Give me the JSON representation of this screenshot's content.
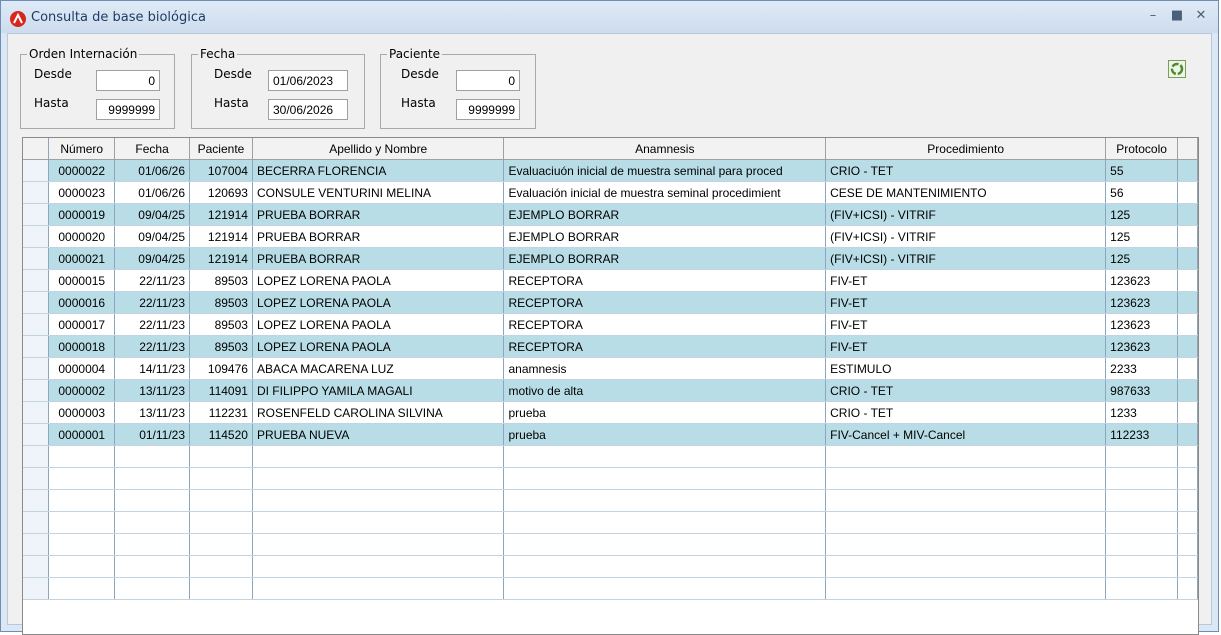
{
  "window": {
    "title": "Consulta de base biológica"
  },
  "filters": {
    "orden": {
      "legend": "Orden Internación",
      "desde_label": "Desde",
      "desde": "0",
      "hasta_label": "Hasta",
      "hasta": "9999999"
    },
    "fecha": {
      "legend": "Fecha",
      "desde_label": "Desde",
      "desde": "01/06/2023",
      "hasta_label": "Hasta",
      "hasta": "30/06/2026"
    },
    "paciente": {
      "legend": "Paciente",
      "desde_label": "Desde",
      "desde": "0",
      "hasta_label": "Hasta",
      "hasta": "9999999"
    }
  },
  "table": {
    "columns": [
      "Número",
      "Fecha",
      "Paciente",
      "Apellido y Nombre",
      "Anamnesis",
      "Procedimiento",
      "Protocolo"
    ],
    "rows": [
      [
        "0000022",
        "01/06/26",
        "107004",
        " BECERRA FLORENCIA",
        "Evaluaciuón inicial de muestra seminal para proced",
        "CRIO - TET",
        "55"
      ],
      [
        "0000023",
        "01/06/26",
        "120693",
        " CONSULE VENTURINI MELINA",
        "Evaluación inicial de muestra seminal procedimient",
        "CESE DE MANTENIMIENTO",
        "56"
      ],
      [
        "0000019",
        "09/04/25",
        "121914",
        "PRUEBA BORRAR",
        "EJEMPLO BORRAR",
        "(FIV+ICSI) - VITRIF",
        "125"
      ],
      [
        "0000020",
        "09/04/25",
        "121914",
        "PRUEBA BORRAR",
        "EJEMPLO BORRAR",
        "(FIV+ICSI) - VITRIF",
        "125"
      ],
      [
        "0000021",
        "09/04/25",
        "121914",
        "PRUEBA BORRAR",
        "EJEMPLO BORRAR",
        "(FIV+ICSI) - VITRIF",
        "125"
      ],
      [
        "0000015",
        "22/11/23",
        "89503",
        "LOPEZ LORENA PAOLA",
        "RECEPTORA",
        "FIV-ET",
        "123623"
      ],
      [
        "0000016",
        "22/11/23",
        "89503",
        "LOPEZ LORENA PAOLA",
        "RECEPTORA",
        "FIV-ET",
        "123623"
      ],
      [
        "0000017",
        "22/11/23",
        "89503",
        "LOPEZ LORENA PAOLA",
        "RECEPTORA",
        "FIV-ET",
        "123623"
      ],
      [
        "0000018",
        "22/11/23",
        "89503",
        "LOPEZ LORENA PAOLA",
        "RECEPTORA",
        "FIV-ET",
        "123623"
      ],
      [
        "0000004",
        "14/11/23",
        "109476",
        "ABACA MACARENA LUZ",
        "anamnesis",
        "ESTIMULO",
        "2233"
      ],
      [
        "0000002",
        "13/11/23",
        "114091",
        "DI FILIPPO YAMILA MAGALI",
        "motivo de alta",
        "CRIO - TET",
        "987633"
      ],
      [
        "0000003",
        "13/11/23",
        "112231",
        "ROSENFELD CAROLINA SILVINA",
        "prueba",
        "CRIO - TET",
        "1233"
      ],
      [
        "0000001",
        "01/11/23",
        "114520",
        "PRUEBA NUEVA",
        "prueba",
        "FIV-Cancel + MIV-Cancel",
        "112233"
      ]
    ],
    "highlighted_rows": [
      0,
      2,
      4,
      6,
      8,
      10,
      12
    ],
    "empty_rows": 7
  }
}
